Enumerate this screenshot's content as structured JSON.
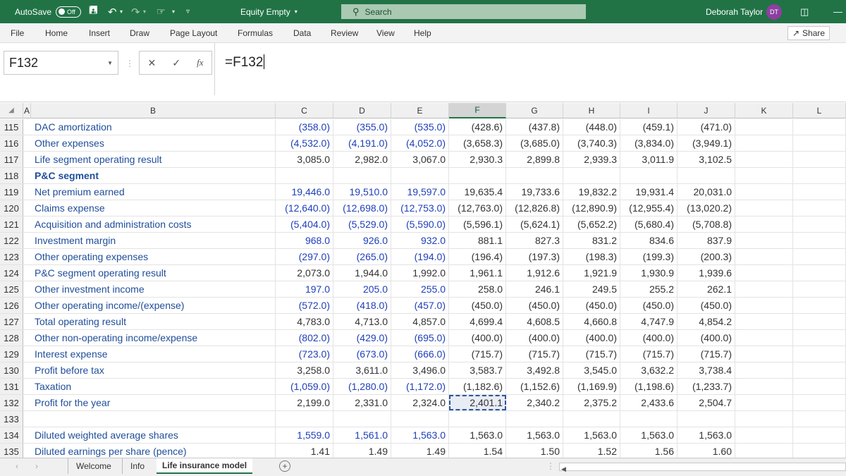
{
  "titlebar": {
    "autosave_label": "AutoSave",
    "autosave_state": "Off",
    "doc_title": "Equity Empty",
    "search_placeholder": "Search",
    "user_name": "Deborah Taylor",
    "user_initials": "DT"
  },
  "menu": [
    "File",
    "Home",
    "Insert",
    "Draw",
    "Page Layout",
    "Formulas",
    "Data",
    "Review",
    "View",
    "Help"
  ],
  "share_label": "Share",
  "formula_bar": {
    "name_box": "F132",
    "formula": "=F132"
  },
  "columns": [
    "A",
    "B",
    "C",
    "D",
    "E",
    "F",
    "G",
    "H",
    "I",
    "J",
    "K",
    "L"
  ],
  "rows": [
    {
      "num": "115",
      "label": "DAC amortization",
      "bold": false,
      "vals": [
        "(358.0)",
        "(355.0)",
        "(535.0)",
        "(428.6)",
        "(437.8)",
        "(448.0)",
        "(459.1)",
        "(471.0)"
      ],
      "input": true
    },
    {
      "num": "116",
      "label": "Other expenses",
      "bold": false,
      "vals": [
        "(4,532.0)",
        "(4,191.0)",
        "(4,052.0)",
        "(3,658.3)",
        "(3,685.0)",
        "(3,740.3)",
        "(3,834.0)",
        "(3,949.1)"
      ],
      "input": true
    },
    {
      "num": "117",
      "label": "Life segment operating result",
      "bold": false,
      "vals": [
        "3,085.0",
        "2,982.0",
        "3,067.0",
        "2,930.3",
        "2,899.8",
        "2,939.3",
        "3,011.9",
        "3,102.5"
      ],
      "input": false
    },
    {
      "num": "118",
      "label": "P&C segment",
      "bold": true,
      "vals": [
        "",
        "",
        "",
        "",
        "",
        "",
        "",
        ""
      ],
      "input": false
    },
    {
      "num": "119",
      "label": "Net premium earned",
      "bold": false,
      "vals": [
        "19,446.0",
        "19,510.0",
        "19,597.0",
        "19,635.4",
        "19,733.6",
        "19,832.2",
        "19,931.4",
        "20,031.0"
      ],
      "input": true
    },
    {
      "num": "120",
      "label": "Claims expense",
      "bold": false,
      "vals": [
        "(12,640.0)",
        "(12,698.0)",
        "(12,753.0)",
        "(12,763.0)",
        "(12,826.8)",
        "(12,890.9)",
        "(12,955.4)",
        "(13,020.2)"
      ],
      "input": true
    },
    {
      "num": "121",
      "label": "Acquisition and administration costs",
      "bold": false,
      "vals": [
        "(5,404.0)",
        "(5,529.0)",
        "(5,590.0)",
        "(5,596.1)",
        "(5,624.1)",
        "(5,652.2)",
        "(5,680.4)",
        "(5,708.8)"
      ],
      "input": true
    },
    {
      "num": "122",
      "label": "Investment margin",
      "bold": false,
      "vals": [
        "968.0",
        "926.0",
        "932.0",
        "881.1",
        "827.3",
        "831.2",
        "834.6",
        "837.9"
      ],
      "input": true
    },
    {
      "num": "123",
      "label": "Other operating expenses",
      "bold": false,
      "vals": [
        "(297.0)",
        "(265.0)",
        "(194.0)",
        "(196.4)",
        "(197.3)",
        "(198.3)",
        "(199.3)",
        "(200.3)"
      ],
      "input": true
    },
    {
      "num": "124",
      "label": "P&C segment operating result",
      "bold": false,
      "vals": [
        "2,073.0",
        "1,944.0",
        "1,992.0",
        "1,961.1",
        "1,912.6",
        "1,921.9",
        "1,930.9",
        "1,939.6"
      ],
      "input": false
    },
    {
      "num": "125",
      "label": "Other investment income",
      "bold": false,
      "vals": [
        "197.0",
        "205.0",
        "255.0",
        "258.0",
        "246.1",
        "249.5",
        "255.2",
        "262.1"
      ],
      "input": true
    },
    {
      "num": "126",
      "label": "Other operating income/(expense)",
      "bold": false,
      "vals": [
        "(572.0)",
        "(418.0)",
        "(457.0)",
        "(450.0)",
        "(450.0)",
        "(450.0)",
        "(450.0)",
        "(450.0)"
      ],
      "input": true
    },
    {
      "num": "127",
      "label": "Total operating result",
      "bold": false,
      "vals": [
        "4,783.0",
        "4,713.0",
        "4,857.0",
        "4,699.4",
        "4,608.5",
        "4,660.8",
        "4,747.9",
        "4,854.2"
      ],
      "input": false
    },
    {
      "num": "128",
      "label": "Other non-operating income/expense",
      "bold": false,
      "vals": [
        "(802.0)",
        "(429.0)",
        "(695.0)",
        "(400.0)",
        "(400.0)",
        "(400.0)",
        "(400.0)",
        "(400.0)"
      ],
      "input": true
    },
    {
      "num": "129",
      "label": "Interest expense",
      "bold": false,
      "vals": [
        "(723.0)",
        "(673.0)",
        "(666.0)",
        "(715.7)",
        "(715.7)",
        "(715.7)",
        "(715.7)",
        "(715.7)"
      ],
      "input": true
    },
    {
      "num": "130",
      "label": "Profit before tax",
      "bold": false,
      "vals": [
        "3,258.0",
        "3,611.0",
        "3,496.0",
        "3,583.7",
        "3,492.8",
        "3,545.0",
        "3,632.2",
        "3,738.4"
      ],
      "input": false
    },
    {
      "num": "131",
      "label": "Taxation",
      "bold": false,
      "vals": [
        "(1,059.0)",
        "(1,280.0)",
        "(1,172.0)",
        "(1,182.6)",
        "(1,152.6)",
        "(1,169.9)",
        "(1,198.6)",
        "(1,233.7)"
      ],
      "input": true
    },
    {
      "num": "132",
      "label": "Profit for the year",
      "bold": false,
      "vals": [
        "2,199.0",
        "2,331.0",
        "2,324.0",
        "2,401.1",
        "2,340.2",
        "2,375.2",
        "2,433.6",
        "2,504.7"
      ],
      "input": false
    },
    {
      "num": "133",
      "label": "",
      "bold": false,
      "vals": [
        "",
        "",
        "",
        "",
        "",
        "",
        "",
        ""
      ],
      "input": false
    },
    {
      "num": "134",
      "label": "Diluted weighted average shares",
      "bold": false,
      "vals": [
        "1,559.0",
        "1,561.0",
        "1,563.0",
        "1,563.0",
        "1,563.0",
        "1,563.0",
        "1,563.0",
        "1,563.0"
      ],
      "input": true
    },
    {
      "num": "135",
      "label": "Diluted earnings per share (pence)",
      "bold": false,
      "vals": [
        "1.41",
        "1.49",
        "1.49",
        "1.54",
        "1.50",
        "1.52",
        "1.56",
        "1.60"
      ],
      "input": false
    }
  ],
  "sheet_tabs": [
    "Welcome",
    "Info",
    "Life insurance model"
  ],
  "active_sheet": "Life insurance model",
  "colors": {
    "excel_green": "#217346",
    "input_blue": "#1f3fb9",
    "label_blue": "#1f4e99"
  }
}
